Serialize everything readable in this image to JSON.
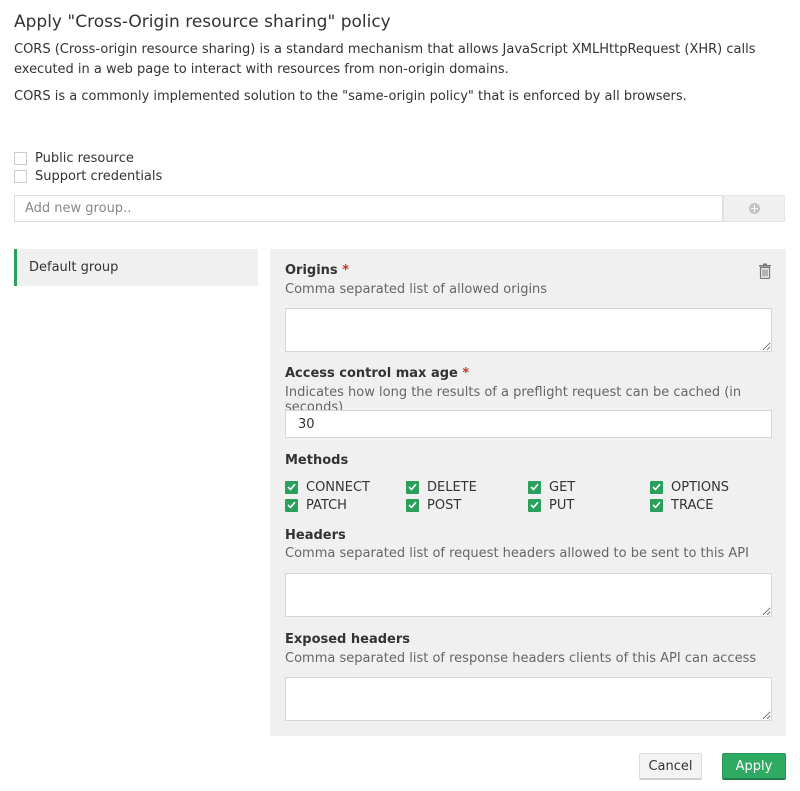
{
  "dialog": {
    "title": "Apply \"Cross-Origin resource sharing\" policy",
    "description_1": "CORS (Cross-origin resource sharing) is a standard mechanism that allows JavaScript XMLHttpRequest (XHR) calls executed in a web page to interact with resources from non-origin domains.",
    "description_2": "CORS is a commonly implemented solution to the \"same-origin policy\" that is enforced by all browsers."
  },
  "options": {
    "public_resource": {
      "label": "Public resource",
      "checked": false
    },
    "support_credentials": {
      "label": "Support credentials",
      "checked": false
    }
  },
  "add_group": {
    "placeholder": "Add new group..",
    "value": "",
    "add_icon": "plus-circle-icon"
  },
  "groups": [
    {
      "label": "Default group",
      "active": true
    }
  ],
  "group_form": {
    "delete_icon": "trash-icon",
    "origins": {
      "label": "Origins",
      "required_mark": "*",
      "help": "Comma separated list of allowed origins",
      "value": ""
    },
    "max_age": {
      "label": "Access control max age",
      "required_mark": "*",
      "help": "Indicates how long the results of a preflight request can be cached (in seconds)",
      "value": "30"
    },
    "methods": {
      "label": "Methods",
      "items": [
        {
          "label": "CONNECT",
          "checked": true
        },
        {
          "label": "DELETE",
          "checked": true
        },
        {
          "label": "GET",
          "checked": true
        },
        {
          "label": "OPTIONS",
          "checked": true
        },
        {
          "label": "PATCH",
          "checked": true
        },
        {
          "label": "POST",
          "checked": true
        },
        {
          "label": "PUT",
          "checked": true
        },
        {
          "label": "TRACE",
          "checked": true
        }
      ]
    },
    "headers": {
      "label": "Headers",
      "help": "Comma separated list of request headers allowed to be sent to this API",
      "value": ""
    },
    "exposed_headers": {
      "label": "Exposed headers",
      "help": "Comma separated list of response headers clients of this API can access",
      "value": ""
    }
  },
  "footer": {
    "cancel_label": "Cancel",
    "apply_label": "Apply"
  },
  "colors": {
    "accent_green": "#2eaa62",
    "required_red": "#c0392b",
    "panel_bg": "#f0f0f0"
  }
}
